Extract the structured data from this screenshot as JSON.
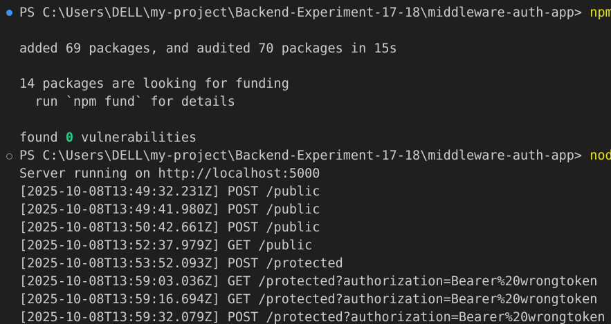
{
  "terminal": {
    "prompts": [
      {
        "text": "PS C:\\Users\\DELL\\my-project\\Backend-Experiment-17-18\\middleware-auth-app> ",
        "command": "npm"
      },
      {
        "text": "PS C:\\Users\\DELL\\my-project\\Backend-Experiment-17-18\\middleware-auth-app> ",
        "command": "node"
      }
    ],
    "npm_output": {
      "added": "added 69 packages, and audited 70 packages in 15s",
      "funding": "14 packages are looking for funding",
      "fund_hint": "  run `npm fund` for details",
      "found_prefix": "found ",
      "vuln_count": "0",
      "found_suffix": " vulnerabilities"
    },
    "server_output": {
      "running": "Server running on http://localhost:5000",
      "logs": [
        "[2025-10-08T13:49:32.231Z] POST /public",
        "[2025-10-08T13:49:41.980Z] POST /public",
        "[2025-10-08T13:50:42.661Z] POST /public",
        "[2025-10-08T13:52:37.979Z] GET /public",
        "[2025-10-08T13:53:52.093Z] POST /protected",
        "[2025-10-08T13:59:03.036Z] GET /protected?authorization=Bearer%20wrongtoken",
        "[2025-10-08T13:59:16.694Z] GET /protected?authorization=Bearer%20wrongtoken",
        "[2025-10-08T13:59:32.079Z] POST /protected?authorization=Bearer%20wrongtoken"
      ]
    },
    "colors": {
      "background": "#1f1f1f",
      "text": "#cccccc",
      "command": "#e5e510",
      "success_count": "#23d18b",
      "decoration_success": "#3794ff",
      "decoration_running": "#8c8c8c"
    }
  }
}
